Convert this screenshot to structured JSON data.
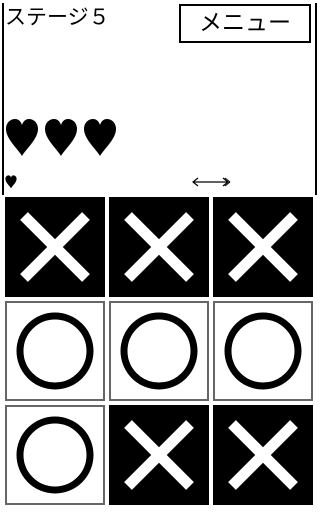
{
  "header": {
    "stage_label": "ステージ５",
    "menu_label": "メニュー"
  },
  "status": {
    "hearts_remaining": 3,
    "small_hearts": 1,
    "icons": [
      "heart-icon",
      "arrow-icon"
    ]
  },
  "board": {
    "rows": [
      [
        "X",
        "X",
        "X"
      ],
      [
        "O",
        "O",
        "O"
      ],
      [
        "O",
        "X",
        "X"
      ]
    ]
  },
  "colors": {
    "background": "#ffffff",
    "ink": "#000000",
    "x_cell_bg": "#000000",
    "x_mark": "#ffffff",
    "o_cell_bg": "#ffffff",
    "o_mark": "#000000"
  }
}
